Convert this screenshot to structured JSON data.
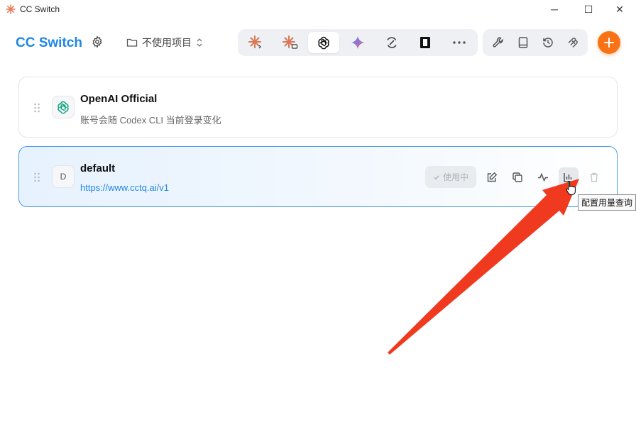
{
  "window": {
    "title": "CC Switch",
    "minimize": "─",
    "maximize": "☐",
    "close": "✕"
  },
  "header": {
    "brand": "CC Switch",
    "project_label": "不使用项目",
    "tabs": [
      {
        "icon": "claude-code-icon",
        "active": false
      },
      {
        "icon": "claude-desktop-icon",
        "active": false
      },
      {
        "icon": "openai-icon",
        "active": true
      },
      {
        "icon": "gemini-icon",
        "active": false
      },
      {
        "icon": "sync-icon",
        "active": false
      },
      {
        "icon": "terminal-icon",
        "active": false
      },
      {
        "icon": "more-icon",
        "active": false
      }
    ],
    "tools": [
      "wrench-icon",
      "book-icon",
      "history-icon",
      "mcp-icon"
    ]
  },
  "providers": [
    {
      "name": "OpenAI Official",
      "subtitle": "账号会随 Codex CLI 当前登录变化"
    },
    {
      "name": "default",
      "avatar": "D",
      "url": "https://www.cctq.ai/v1",
      "status": "使用中"
    }
  ],
  "tooltip": "配置用量查询",
  "colors": {
    "accent": "#1f86e8",
    "add": "#f97316",
    "arrow": "#f03a1f"
  }
}
